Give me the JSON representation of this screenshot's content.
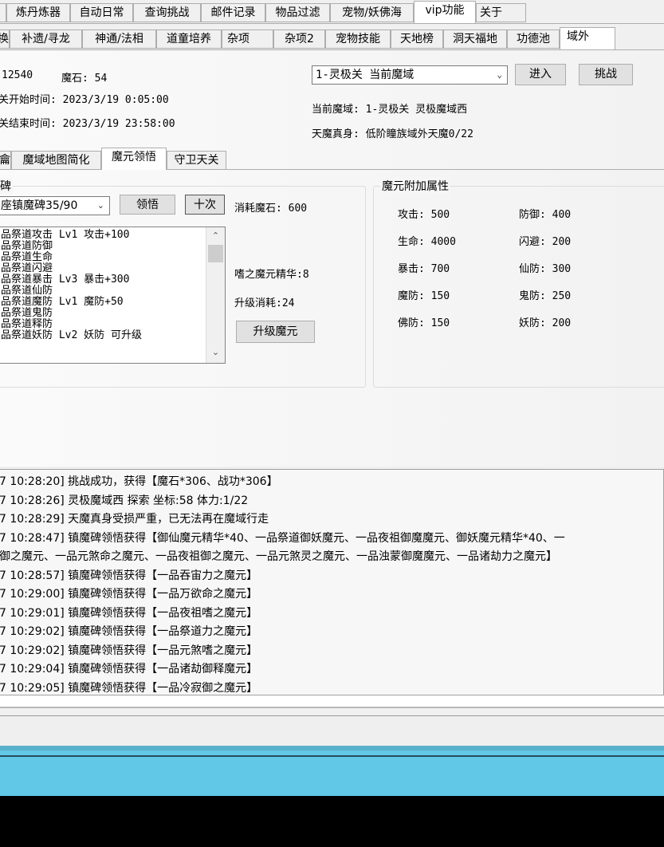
{
  "top_tabs": [
    "炼丹炼器",
    "自动日常",
    "查询挑战",
    "邮件记录",
    "物品过滤",
    "宠物/妖佛海",
    "vip功能",
    "关于"
  ],
  "top_tab_selected": "vip功能",
  "sub_tabs": [
    "换",
    "补遗/寻龙",
    "神通/法相",
    "道童培养",
    "杂项",
    "杂项2",
    "宠物技能",
    "天地榜",
    "洞天福地",
    "功德池",
    "域外"
  ],
  "sub_tab_selected": "域外",
  "info": {
    "value1": "12540",
    "mo_stone": "魔石: 54",
    "start_time": "关开始时间: 2023/3/19 0:05:00",
    "end_time": "关结束时间: 2023/3/19 23:58:00"
  },
  "domain_select": "1-灵极关 当前魔域",
  "enter_button": "进入",
  "challenge_button": "挑战",
  "current_domain": "当前魔域: 1-灵极关 灵极魔域西",
  "demon_body": "天魔真身: 低阶瞳族域外天魔0/22",
  "inner_tabs": [
    "龠",
    "魔域地图简化",
    "魔元领悟",
    "守卫天关"
  ],
  "inner_tab_selected": "魔元领悟",
  "stele": {
    "group_title": "碑",
    "select": "座镇魔碑35/90",
    "comprehend_button": "领悟",
    "ten_button": "十次",
    "cost": "消耗魔石: 600",
    "list": [
      "品祭道攻击 Lv1 攻击+100",
      "品祭道防御",
      "品祭道生命",
      "品祭道闪避",
      "品祭道暴击 Lv3 暴击+300",
      "品祭道仙防",
      "品祭道魔防 Lv1 魔防+50",
      "品祭道鬼防",
      "品祭道释防",
      "品祭道妖防 Lv2 妖防 可升级"
    ],
    "essence": "嗜之魔元精华:8",
    "upgrade_cost": "升级消耗:24",
    "upgrade_button": "升级魔元"
  },
  "attrs": {
    "group_title": "魔元附加属性",
    "items": [
      "攻击: 500",
      "防御: 400",
      "生命: 4000",
      "闪避: 200",
      "暴击: 700",
      "仙防: 300",
      "魔防: 150",
      "鬼防: 250",
      "佛防: 150",
      "妖防: 200"
    ]
  },
  "log": [
    "7 10:28:20] 挑战成功，获得【魔石*306、战功*306】",
    "7 10:28:26] 灵极魔域西 探索 坐标:58 体力:1/22",
    "7 10:28:29] 天魔真身受损严重，已无法再在魔域行走",
    "7 10:28:47] 镇魔碑领悟获得【御仙魔元精华*40、一品祭道御妖魔元、一品夜祖御魔魔元、御妖魔元精华*40、一",
    "御之魔元、一品元煞命之魔元、一品夜祖御之魔元、一品元煞灵之魔元、一品浊蒙御魔魔元、一品诸劫力之魔元】",
    "7 10:28:57] 镇魔碑领悟获得【一品吞宙力之魔元】",
    "7 10:29:00] 镇魔碑领悟获得【一品万欲命之魔元】",
    "7 10:29:01] 镇魔碑领悟获得【一品夜祖嗜之魔元】",
    "7 10:29:02] 镇魔碑领悟获得【一品祭道力之魔元】",
    "7 10:29:02] 镇魔碑领悟获得【一品元煞嗜之魔元】",
    "7 10:29:04] 镇魔碑领悟获得【一品诸劫御释魔元】",
    "7 10:29:05] 镇魔碑领悟获得【一品冷寂御之魔元】"
  ],
  "colors": {
    "taskbar": "#62c8e8",
    "desktop": "#000000"
  }
}
